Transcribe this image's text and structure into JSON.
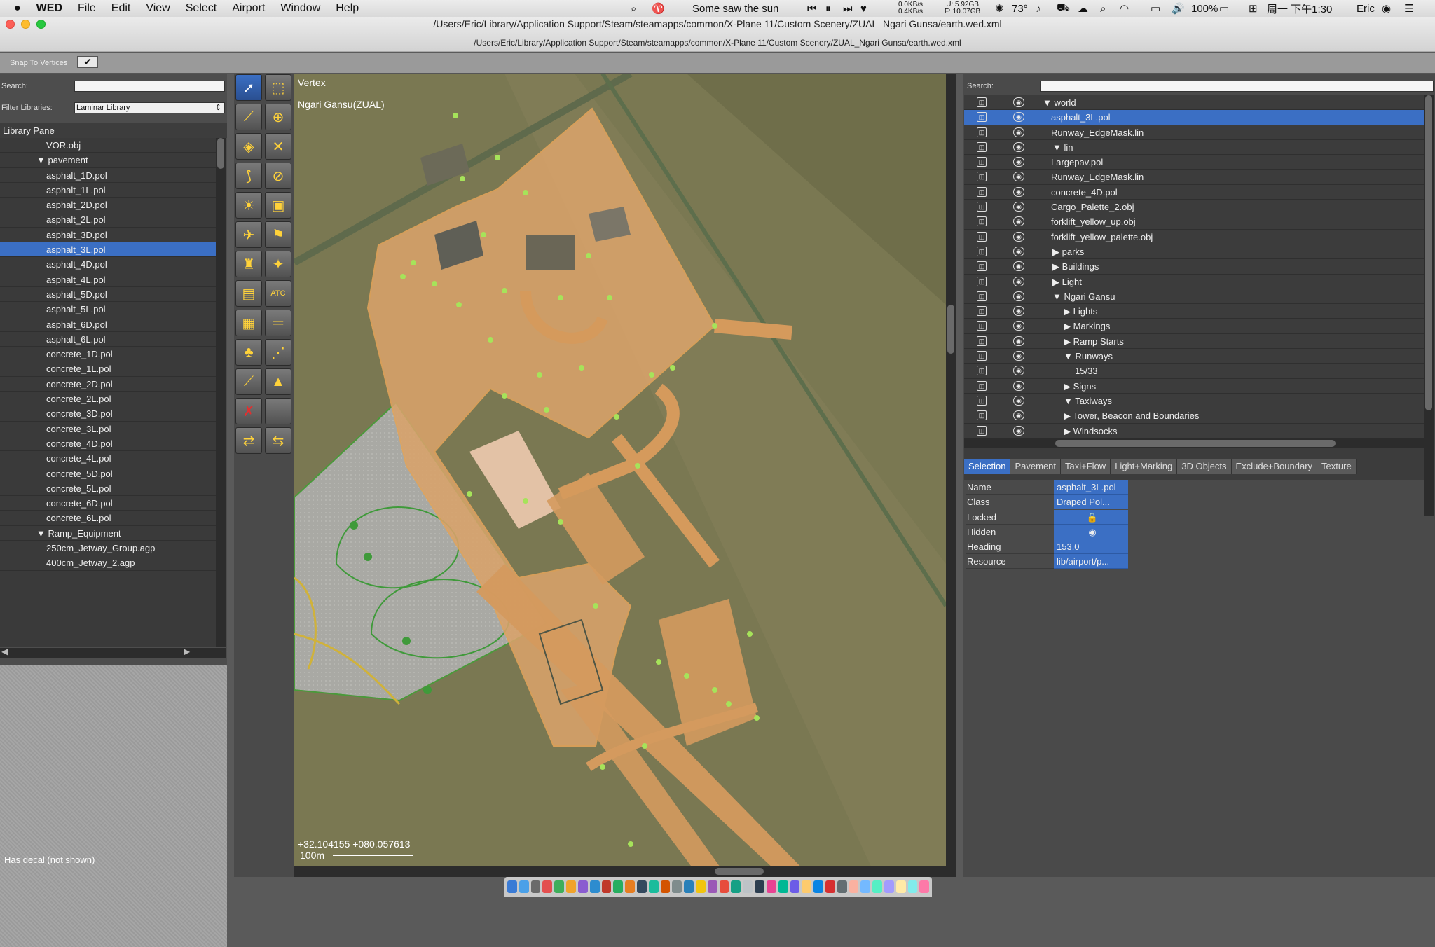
{
  "menubar": {
    "app": "WED",
    "items": [
      "File",
      "Edit",
      "View",
      "Select",
      "Airport",
      "Window",
      "Help"
    ],
    "now_playing": "Some saw the sun",
    "net_up": "0.0KB/s",
    "net_down": "0.4KB/s",
    "disk_u": "U: 5.92GB",
    "disk_f": "F: 10.07GB",
    "temp": "73°",
    "battery": "100%",
    "clock": "周一 下午1:30",
    "user": "Eric"
  },
  "window": {
    "title": "/Users/Eric/Library/Application Support/Steam/steamapps/common/X-Plane 11/Custom Scenery/ZUAL_Ngari Gunsa/earth.wed.xml",
    "path": "/Users/Eric/Library/Application Support/Steam/steamapps/common/X-Plane 11/Custom Scenery/ZUAL_Ngari Gunsa/earth.wed.xml"
  },
  "toolbar": {
    "snap_label": "Snap To Vertices",
    "snap_check": "✔"
  },
  "library": {
    "search_label": "Search:",
    "filter_label": "Filter Libraries:",
    "filter_value": "Laminar Library",
    "pane_title": "Library Pane",
    "items": [
      {
        "label": "VOR.obj",
        "indent": 3,
        "sel": false
      },
      {
        "label": "▼ pavement",
        "indent": 2,
        "sel": false
      },
      {
        "label": "asphalt_1D.pol",
        "indent": 3,
        "sel": false
      },
      {
        "label": "asphalt_1L.pol",
        "indent": 3,
        "sel": false
      },
      {
        "label": "asphalt_2D.pol",
        "indent": 3,
        "sel": false
      },
      {
        "label": "asphalt_2L.pol",
        "indent": 3,
        "sel": false
      },
      {
        "label": "asphalt_3D.pol",
        "indent": 3,
        "sel": false
      },
      {
        "label": "asphalt_3L.pol",
        "indent": 3,
        "sel": true
      },
      {
        "label": "asphalt_4D.pol",
        "indent": 3,
        "sel": false
      },
      {
        "label": "asphalt_4L.pol",
        "indent": 3,
        "sel": false
      },
      {
        "label": "asphalt_5D.pol",
        "indent": 3,
        "sel": false
      },
      {
        "label": "asphalt_5L.pol",
        "indent": 3,
        "sel": false
      },
      {
        "label": "asphalt_6D.pol",
        "indent": 3,
        "sel": false
      },
      {
        "label": "asphalt_6L.pol",
        "indent": 3,
        "sel": false
      },
      {
        "label": "concrete_1D.pol",
        "indent": 3,
        "sel": false
      },
      {
        "label": "concrete_1L.pol",
        "indent": 3,
        "sel": false
      },
      {
        "label": "concrete_2D.pol",
        "indent": 3,
        "sel": false
      },
      {
        "label": "concrete_2L.pol",
        "indent": 3,
        "sel": false
      },
      {
        "label": "concrete_3D.pol",
        "indent": 3,
        "sel": false
      },
      {
        "label": "concrete_3L.pol",
        "indent": 3,
        "sel": false
      },
      {
        "label": "concrete_4D.pol",
        "indent": 3,
        "sel": false
      },
      {
        "label": "concrete_4L.pol",
        "indent": 3,
        "sel": false
      },
      {
        "label": "concrete_5D.pol",
        "indent": 3,
        "sel": false
      },
      {
        "label": "concrete_5L.pol",
        "indent": 3,
        "sel": false
      },
      {
        "label": "concrete_6D.pol",
        "indent": 3,
        "sel": false
      },
      {
        "label": "concrete_6L.pol",
        "indent": 3,
        "sel": false
      },
      {
        "label": "▼ Ramp_Equipment",
        "indent": 2,
        "sel": false
      },
      {
        "label": "250cm_Jetway_Group.agp",
        "indent": 3,
        "sel": false
      },
      {
        "label": "400cm_Jetway_2.agp",
        "indent": 3,
        "sel": false
      }
    ],
    "decal_note": "Has decal (not shown)"
  },
  "tools": [
    {
      "name": "vertex-tool",
      "glyph": "➚",
      "active": true
    },
    {
      "name": "marquee-tool",
      "glyph": "⬚",
      "active": false
    },
    {
      "name": "runway-tool",
      "glyph": "⟋",
      "active": false
    },
    {
      "name": "helipad-tool",
      "glyph": "⊕",
      "active": false
    },
    {
      "name": "sealane-tool",
      "glyph": "◈",
      "active": false
    },
    {
      "name": "taxiway-tool",
      "glyph": "✕",
      "active": false
    },
    {
      "name": "taxiline-tool",
      "glyph": "⟆",
      "active": false
    },
    {
      "name": "hole-tool",
      "glyph": "⊘",
      "active": false
    },
    {
      "name": "light-tool",
      "glyph": "☀",
      "active": false
    },
    {
      "name": "sign-tool",
      "glyph": "▣",
      "active": false
    },
    {
      "name": "ramp-start-tool",
      "glyph": "✈",
      "active": false
    },
    {
      "name": "windsock-tool",
      "glyph": "⚑",
      "active": false
    },
    {
      "name": "tower-tool",
      "glyph": "♜",
      "active": false
    },
    {
      "name": "beacon-tool",
      "glyph": "✦",
      "active": false
    },
    {
      "name": "boundary-tool",
      "glyph": "▤",
      "active": false
    },
    {
      "name": "atc-tool",
      "glyph": "ATC",
      "active": false
    },
    {
      "name": "facade-tool",
      "glyph": "▦",
      "active": false
    },
    {
      "name": "line-tool",
      "glyph": "═",
      "active": false
    },
    {
      "name": "forest-tool",
      "glyph": "♣",
      "active": false
    },
    {
      "name": "string-tool",
      "glyph": "⋰",
      "active": false
    },
    {
      "name": "polygon-tool",
      "glyph": "⟋",
      "active": false
    },
    {
      "name": "exclusion-tool",
      "glyph": "▲",
      "active": false
    },
    {
      "name": "delete-tool",
      "glyph": "✗",
      "active": false
    },
    {
      "name": "blank-tool",
      "glyph": "",
      "active": false
    },
    {
      "name": "route-tool",
      "glyph": "⇄",
      "active": false
    },
    {
      "name": "ground-route-tool",
      "glyph": "⇆",
      "active": false
    }
  ],
  "map": {
    "tool_label": "Vertex",
    "airport": "Ngari Gansu(ZUAL)",
    "coords": "+32.104155 +080.057613",
    "scale": "100m"
  },
  "hierarchy": {
    "search_label": "Search:",
    "items": [
      {
        "label": "▼ world",
        "indent": 0,
        "sel": false
      },
      {
        "label": "asphalt_3L.pol",
        "indent": 1,
        "sel": true
      },
      {
        "label": "Runway_EdgeMask.lin",
        "indent": 1,
        "sel": false
      },
      {
        "label": "▼ lin",
        "indent": 1,
        "sel": false
      },
      {
        "label": "Largepav.pol",
        "indent": 1,
        "sel": false
      },
      {
        "label": "Runway_EdgeMask.lin",
        "indent": 1,
        "sel": false
      },
      {
        "label": "concrete_4D.pol",
        "indent": 1,
        "sel": false
      },
      {
        "label": "Cargo_Palette_2.obj",
        "indent": 1,
        "sel": false
      },
      {
        "label": "forklift_yellow_up.obj",
        "indent": 1,
        "sel": false
      },
      {
        "label": "forklift_yellow_palette.obj",
        "indent": 1,
        "sel": false
      },
      {
        "label": "▶ parks",
        "indent": 1,
        "sel": false
      },
      {
        "label": "▶ Buildings",
        "indent": 1,
        "sel": false
      },
      {
        "label": "▶ Light",
        "indent": 1,
        "sel": false
      },
      {
        "label": "▼ Ngari Gansu",
        "indent": 1,
        "sel": false
      },
      {
        "label": "▶ Lights",
        "indent": 2,
        "sel": false
      },
      {
        "label": "▶ Markings",
        "indent": 2,
        "sel": false
      },
      {
        "label": "▶ Ramp Starts",
        "indent": 2,
        "sel": false
      },
      {
        "label": "▼ Runways",
        "indent": 2,
        "sel": false
      },
      {
        "label": "15/33",
        "indent": 3,
        "sel": false
      },
      {
        "label": "▶ Signs",
        "indent": 2,
        "sel": false
      },
      {
        "label": "▼ Taxiways",
        "indent": 2,
        "sel": false
      },
      {
        "label": "▶ Tower, Beacon and Boundaries",
        "indent": 2,
        "sel": false
      },
      {
        "label": "▶ Windsocks",
        "indent": 2,
        "sel": false
      }
    ]
  },
  "tabs": [
    {
      "label": "Selection",
      "sel": true
    },
    {
      "label": "Pavement",
      "sel": false
    },
    {
      "label": "Taxi+Flow",
      "sel": false
    },
    {
      "label": "Light+Marking",
      "sel": false
    },
    {
      "label": "3D Objects",
      "sel": false
    },
    {
      "label": "Exclude+Boundary",
      "sel": false
    },
    {
      "label": "Texture",
      "sel": false
    }
  ],
  "properties": [
    {
      "key": "Name",
      "value": "asphalt_3L.pol"
    },
    {
      "key": "Class",
      "value": "Draped Pol..."
    },
    {
      "key": "Locked",
      "value": "🔒"
    },
    {
      "key": "Hidden",
      "value": "◉"
    },
    {
      "key": "Heading",
      "value": "153.0"
    },
    {
      "key": "Resource",
      "value": "lib/airport/p..."
    }
  ]
}
